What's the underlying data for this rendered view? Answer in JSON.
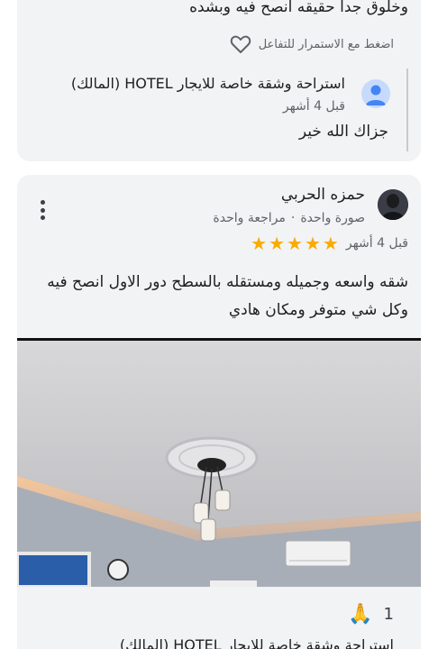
{
  "previous_review": {
    "text_tail": "وخلوق جداً حقيقه أنصح فيه وبشده",
    "like_hint": "اضغط مع الاستمرار للتفاعل",
    "like_icon": "heart-outline-icon",
    "owner_reply": {
      "name": "استراحة وشقة خاصة للايجار HOTEL (المالك)",
      "time": "قبل 4 أشهر",
      "text": "جزاك الله خير"
    }
  },
  "review": {
    "author": "حمزه الحربي",
    "meta_reviews": "مراجعة واحدة",
    "meta_separator": "·",
    "meta_photos": "صورة واحدة",
    "rating": 5,
    "star_glyph": "★",
    "time": "قبل 4 أشهر",
    "text": "شقه واسعه وجميله ومستقله بالسطح دور الاول انصح فيه وكل شي متوفر ومكان هادي",
    "reaction_icon": "🙏",
    "reaction_count": "1",
    "owner_reply_name": "استراحة وشقة خاصة للايجار HOTEL (المالك)"
  },
  "colors": {
    "card_bg": "#f1f3f4",
    "star": "#f9ab00",
    "secondary_text": "#5f6368"
  }
}
